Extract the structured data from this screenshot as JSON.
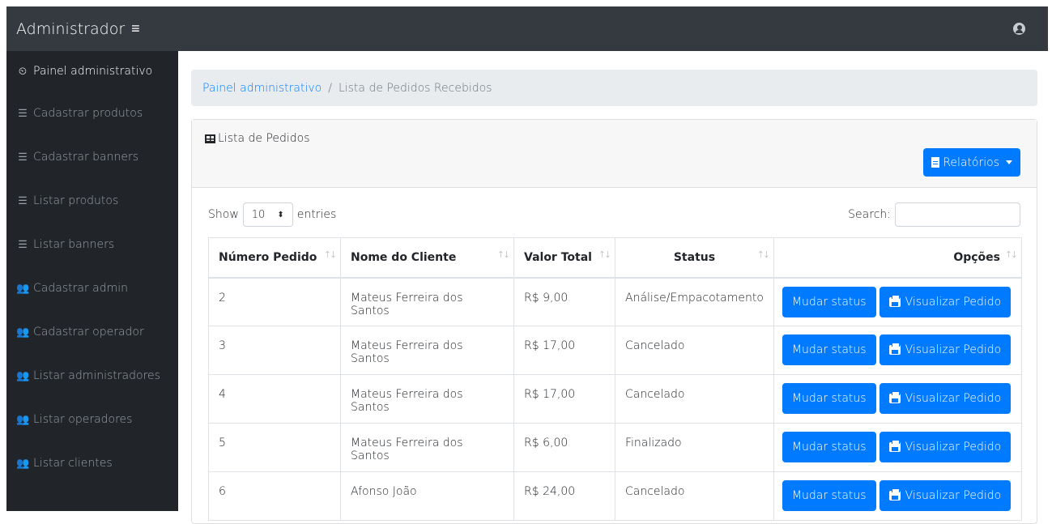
{
  "header": {
    "brand": "Administrador",
    "menu_icon": "≡",
    "user_icon": "user-circle-icon"
  },
  "sidebar": {
    "items": [
      {
        "label": "Painel administrativo",
        "icon": "tachometer-icon",
        "glyph": "⏲",
        "active": true
      },
      {
        "label": "Cadastrar produtos",
        "icon": "list-icon",
        "glyph": "☰"
      },
      {
        "label": "Cadastrar banners",
        "icon": "list-icon",
        "glyph": "☰"
      },
      {
        "label": "Listar produtos",
        "icon": "list-icon",
        "glyph": "☰"
      },
      {
        "label": "Listar banners",
        "icon": "list-icon",
        "glyph": "☰"
      },
      {
        "label": "Cadastrar admin",
        "icon": "users-icon",
        "glyph": "👥"
      },
      {
        "label": "Cadastrar operador",
        "icon": "users-icon",
        "glyph": "👥"
      },
      {
        "label": "Listar administradores",
        "icon": "users-icon",
        "glyph": "👥"
      },
      {
        "label": "Listar operadores",
        "icon": "users-icon",
        "glyph": "👥"
      },
      {
        "label": "Listar clientes",
        "icon": "users-icon",
        "glyph": "👥"
      }
    ]
  },
  "breadcrumb": {
    "link": "Painel administrativo",
    "separator": "/",
    "current": "Lista de Pedidos Recebidos"
  },
  "card": {
    "title": "Lista de Pedidos",
    "reports_button": "Relatórios"
  },
  "datatable": {
    "show_label": "Show",
    "entries_label": "entries",
    "page_size": "10",
    "search_label": "Search:",
    "columns": [
      "Número Pedido",
      "Nome do Cliente",
      "Valor Total",
      "Status",
      "Opções"
    ],
    "sort_glyph": "↑↓",
    "rows": [
      {
        "numero": "2",
        "cliente": "Mateus Ferreira dos Santos",
        "valor": "R$ 9,00",
        "status": "Análise/Empacotamento"
      },
      {
        "numero": "3",
        "cliente": "Mateus Ferreira dos Santos",
        "valor": "R$ 17,00",
        "status": "Cancelado"
      },
      {
        "numero": "4",
        "cliente": "Mateus Ferreira dos Santos",
        "valor": "R$ 17,00",
        "status": "Cancelado"
      },
      {
        "numero": "5",
        "cliente": "Mateus Ferreira dos Santos",
        "valor": "R$ 6,00",
        "status": "Finalizado"
      },
      {
        "numero": "6",
        "cliente": "Afonso João",
        "valor": "R$ 24,00",
        "status": "Cancelado"
      }
    ],
    "btn_change_status": "Mudar status",
    "btn_view_order": "Visualizar Pedido"
  },
  "colors": {
    "topbar": "#343a40",
    "sidebar": "#212529",
    "primary": "#007bff",
    "breadcrumb_bg": "#e9ecef"
  }
}
